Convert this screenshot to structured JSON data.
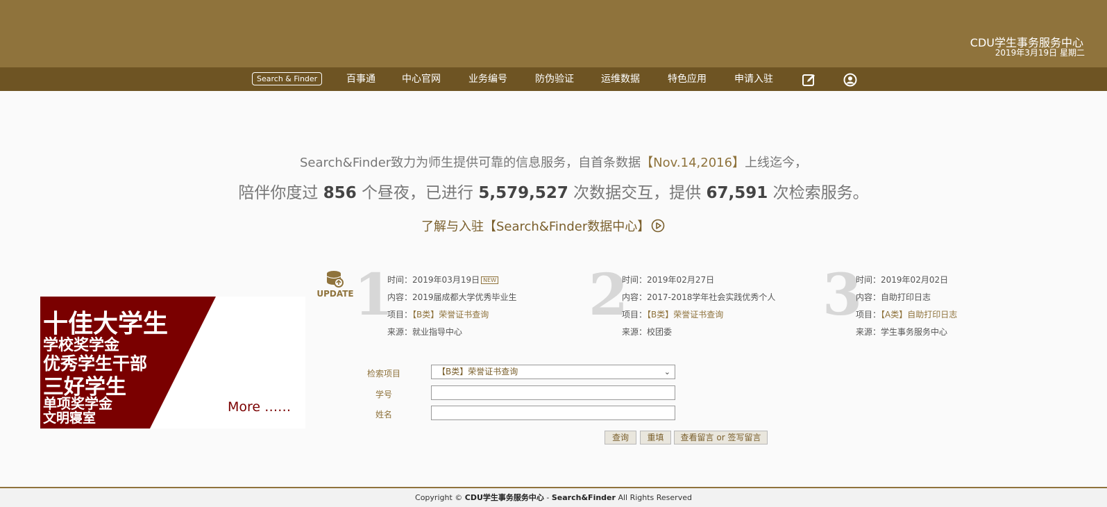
{
  "header": {
    "site_name": "CDU学生事务服务中心",
    "date": "2019年3月19日 星期二"
  },
  "nav": {
    "search_finder": "Search & Finder",
    "items": [
      "百事通",
      "中心官网",
      "业务编号",
      "防伪验证",
      "运维数据",
      "特色应用",
      "申请入驻"
    ],
    "icons": [
      "edit-icon",
      "user-icon"
    ]
  },
  "intro": {
    "line1_pre": "Search&Finder致力为师生提供可靠的信息服务，自首条数据",
    "line1_date": "【Nov.14,2016】",
    "line1_post": "上线迄今，",
    "stats_pre": "陪伴你度过 ",
    "days": "856",
    "stats_mid1": " 个昼夜，已进行 ",
    "interactions": "5,579,527",
    "stats_mid2": " 次数据交互，提供 ",
    "searches": "67,591",
    "stats_post": " 次检索服务。",
    "join_link": "了解与入驻【Search&Finder数据中心】"
  },
  "updates": {
    "label": "UPDATE",
    "new_badge": "NEW",
    "time_label": "时间：",
    "content_label": "内容：",
    "project_label": "项目：",
    "source_label": "来源：",
    "items": [
      {
        "num": "1",
        "time": "2019年03月19日",
        "content": "2019届成都大学优秀毕业生",
        "project": "【B类】荣誉证书查询",
        "source": "就业指导中心"
      },
      {
        "num": "2",
        "time": "2019年02月27日",
        "content": "2017-2018学年社会实践优秀个人",
        "project": "【B类】荣誉证书查询",
        "source": "校团委"
      },
      {
        "num": "3",
        "time": "2019年02月02日",
        "content": "自助打印日志",
        "project": "【A类】自助打印日志",
        "source": "学生事务服务中心"
      }
    ]
  },
  "banner": {
    "lines": [
      "十佳大学生",
      "学校奖学金",
      "优秀学生干部",
      "三好学生",
      "单项奖学金",
      "文明寝室"
    ],
    "more": "More ……"
  },
  "form": {
    "project_label": "检索项目",
    "project_value": "【B类】荣誉证书查询",
    "student_id_label": "学号",
    "name_label": "姓名",
    "query_button": "查询",
    "reset_button": "重填",
    "message_button": "查看留言 or 签写留言"
  },
  "footer": {
    "copyright": "Copyright ©",
    "org": "CDU学生事务服务中心",
    "sep": " - ",
    "brand": "Search&Finder",
    "rights": "All Rights Reserved"
  },
  "colors": {
    "header_bg": "#8f733c",
    "nav_bg": "#6e5423",
    "banner_red": "#7a0000"
  }
}
